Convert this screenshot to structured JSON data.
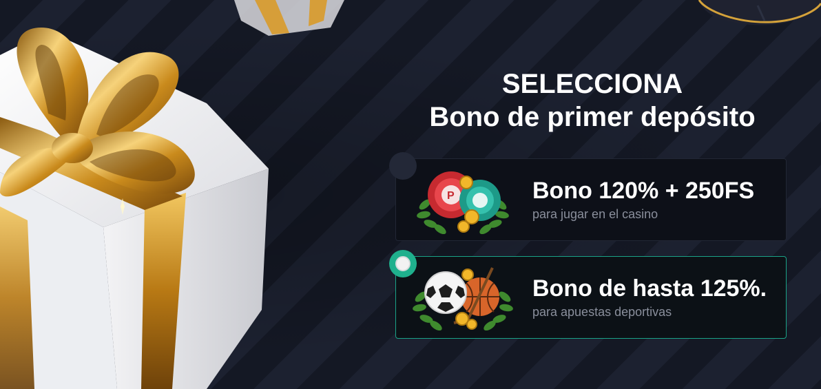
{
  "heading": {
    "line1": "SELECCIONA",
    "line2": "Bono de primer depósito"
  },
  "options": [
    {
      "title": "Bono 120% + 250FS",
      "subtitle": "para jugar en el casino",
      "selected": false,
      "icon": "casino-chips-icon"
    },
    {
      "title": "Bono de hasta 125%.",
      "subtitle": "para apuestas deportivas",
      "selected": true,
      "icon": "sports-balls-icon"
    }
  ],
  "colors": {
    "background": "#161a26",
    "accent": "#1fb08d",
    "card": "#0d1018",
    "gold": "#e0a92a"
  }
}
